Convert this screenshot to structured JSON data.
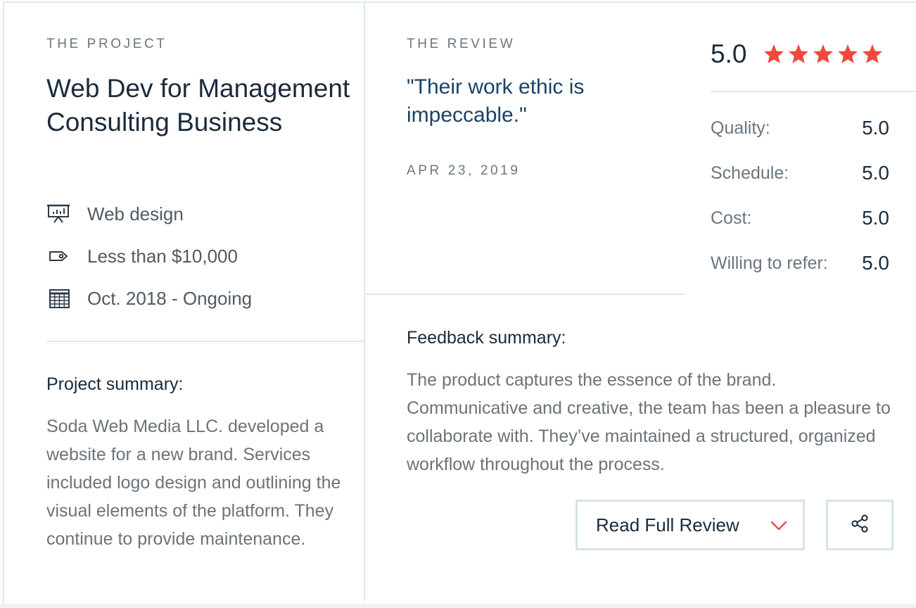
{
  "project": {
    "eyebrow": "THE PROJECT",
    "title": "Web Dev for Management Consulting Business",
    "meta": [
      {
        "icon": "presentation-board-icon",
        "text": "Web design"
      },
      {
        "icon": "price-tag-icon",
        "text": "Less than $10,000"
      },
      {
        "icon": "calendar-icon",
        "text": "Oct. 2018 - Ongoing"
      }
    ],
    "summary_heading": "Project summary:",
    "summary_text": "Soda Web Media LLC. developed a website for a new brand. Services included logo design and outlining the visual elements of the platform. They continue to provide maintenance."
  },
  "review": {
    "eyebrow": "THE REVIEW",
    "quote": "\"Their work ethic is impeccable.\"",
    "date": "APR 23, 2019",
    "feedback_heading": "Feedback summary:",
    "feedback_text": "The product captures the essence of the brand. Communicative and creative, the team has been a pleasure to collaborate with. They’ve maintained a structured, organized workflow throughout the process."
  },
  "rating": {
    "overall": "5.0",
    "stars": 5,
    "star_color": "#ee4a3c",
    "scores": [
      {
        "label": "Quality:",
        "value": "5.0"
      },
      {
        "label": "Schedule:",
        "value": "5.0"
      },
      {
        "label": "Cost:",
        "value": "5.0"
      },
      {
        "label": "Willing to refer:",
        "value": "5.0"
      }
    ]
  },
  "actions": {
    "read_full_review": "Read Full Review",
    "read_icon": "chevron-down-icon",
    "share_icon": "share-icon"
  }
}
